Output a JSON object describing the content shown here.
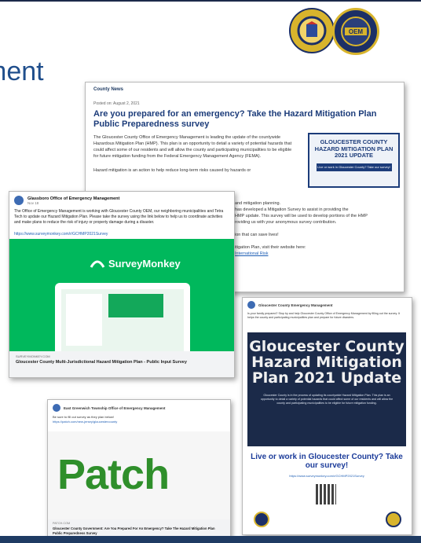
{
  "slide": {
    "title_fragment": "ment",
    "accent_color": "#1f4e8c"
  },
  "seals": {
    "county_seal_icon": "gloucester-county-seal-icon",
    "oem_seal_label": "OEM",
    "oem_seal_top_text": "GLOUCESTER COUNTY"
  },
  "county_news": {
    "label": "County News",
    "posted": "Posted on: August 2, 2021",
    "headline": "Are you prepared for an emergency? Take the Hazard Mitigation Plan Public Preparedness survey",
    "paragraph1": "The Gloucester County Office of Emergency Management is leading the update of the countywide Hazardous Mitigation Plan (HMP). This plan is an opportunity to detail a variety of potential hazards that could affect some of our residents and will allow the county and participating municipalities to be eligible for future mitigation funding from the Federal Emergency Management Agency (FEMA).",
    "paragraph2": "Hazard mitigation is an action to help reduce long-term risks caused by hazards or",
    "paragraph3_a": "and mitigation planning.",
    "paragraph3_b": "has developed a Mitigation Survey to assist in providing the",
    "paragraph3_c": "HMP update. This survey will be used to develop portions of the HMP",
    "paragraph3_d": "roviding us with your anonymous survey contribution.",
    "paragraph4": "ion that can save lives!",
    "paragraph5": "itigation Plan, visit their website here:",
    "link": "International Risk",
    "promo_title": "GLOUCESTER COUNTY HAZARD MITIGATION PLAN 2021 UPDATE",
    "promo_bar": "Live or work in Gloucester County? Take our survey!"
  },
  "glassboro_post": {
    "page_name": "Glassboro Office of Emergency Management",
    "date": "Nov 18",
    "text": "The Office of Emergency Management is working with Gloucester County OEM, our neighboring municipalities and Tetra Tech to update our Hazard Mitigation Plan. Please take the survey using the link below to help us to coordinate activities and make plans to reduce the risk of injury or property damage during a disaster.",
    "link": "https://www.surveymonkey.com/r/GCHMP2021Survey",
    "brand": "SurveyMonkey",
    "source": "SURVEYMONKEY.COM",
    "caption": "Gloucester County Multi-Jurisdictional Hazard Mitigation Plan - Public Input Survey"
  },
  "poster_post": {
    "page_name": "Gloucester County Emergency Management",
    "intro": "Is your family prepared? Stop by and help Gloucester County Office of Emergency Management by filling out the survey. It helps the county and participating municipalities plan and prepare for future disasters.",
    "poster_title": "Gloucester County Hazard Mitigation Plan 2021 Update",
    "poster_body": "Gloucester County is in the process of updating its countywide Hazard Mitigation Plan. This plan is an opportunity to detail a variety of potential hazards that could affect some of our residents and will allow the county and participating municipalities to be eligible for future mitigation funding.",
    "call_to_action": "Live or work in Gloucester County? Take our survey!",
    "survey_url": "https://www.surveymonkey.com/r/GCHMP2021Survey"
  },
  "patch_post": {
    "page_name": "East Greenwich Township Office of Emergency Management",
    "text": "Be sure to fill out survey as they plan below!",
    "link": "https://patch.com/new-jersey/gloucestercounty",
    "logo": "Patch",
    "source": "PATCH.COM",
    "caption": "Gloucester County Government: Are You Prepared For An Emergency? Take The Hazard Mitigation Plan Public Preparedness Survey"
  }
}
